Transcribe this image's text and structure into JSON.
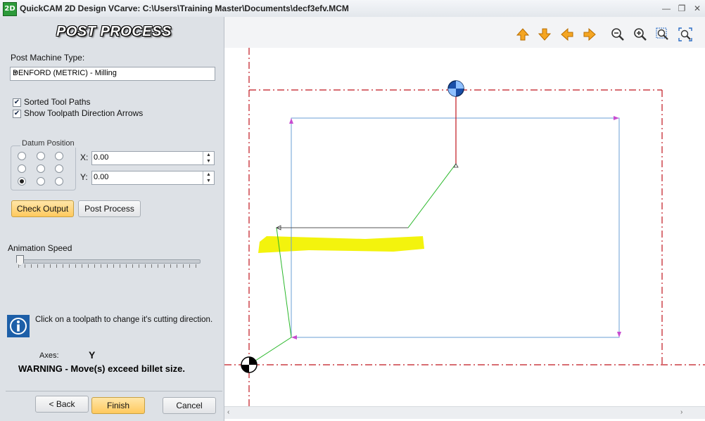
{
  "window": {
    "app_icon_text": "2D",
    "title": "QuickCAM 2D Design VCarve: C:\\Users\\Training Master\\Documents\\decf3efv.MCM",
    "minimize_glyph": "—",
    "restore_glyph": "❐",
    "close_glyph": "✕"
  },
  "panel": {
    "title": "POST PROCESS",
    "machine_label": "Post Machine Type:",
    "machine_value": "DENFORD (METRIC) - Milling",
    "sorted_label": "Sorted Tool Paths",
    "sorted_checked": true,
    "arrows_label": "Show Toolpath Direction Arrows",
    "arrows_checked": true,
    "datum_title": "Datum Position",
    "datum_selected_index": 6,
    "x_label": "X:",
    "x_value": "0.00",
    "y_label": "Y:",
    "y_value": "0.00",
    "check_output_label": "Check Output",
    "post_process_label": "Post Process",
    "animation_label": "Animation Speed",
    "animation_value": 0,
    "info_text": "Click on a toolpath to change it's cutting direction.",
    "axes_label": "Axes:",
    "axes_value": "Y",
    "warning_text": "WARNING - Move(s) exceed billet size.",
    "back_label": "< Back",
    "finish_label": "Finish",
    "cancel_label": "Cancel"
  },
  "toolbar": {
    "icons": [
      "pan-up-icon",
      "pan-down-icon",
      "pan-left-icon",
      "pan-right-icon",
      "zoom-out-icon",
      "zoom-in-icon",
      "zoom-window-icon",
      "zoom-fit-icon"
    ]
  },
  "colors": {
    "billet_line": "#c0161e",
    "toolpath": "#6a9fd6",
    "rapid_move": "#2ab82a",
    "plunge_move": "#c0161e",
    "direction_arrow": "#c84cd0",
    "highlight": "#f2f200",
    "arrow_fill": "#f5a623"
  }
}
